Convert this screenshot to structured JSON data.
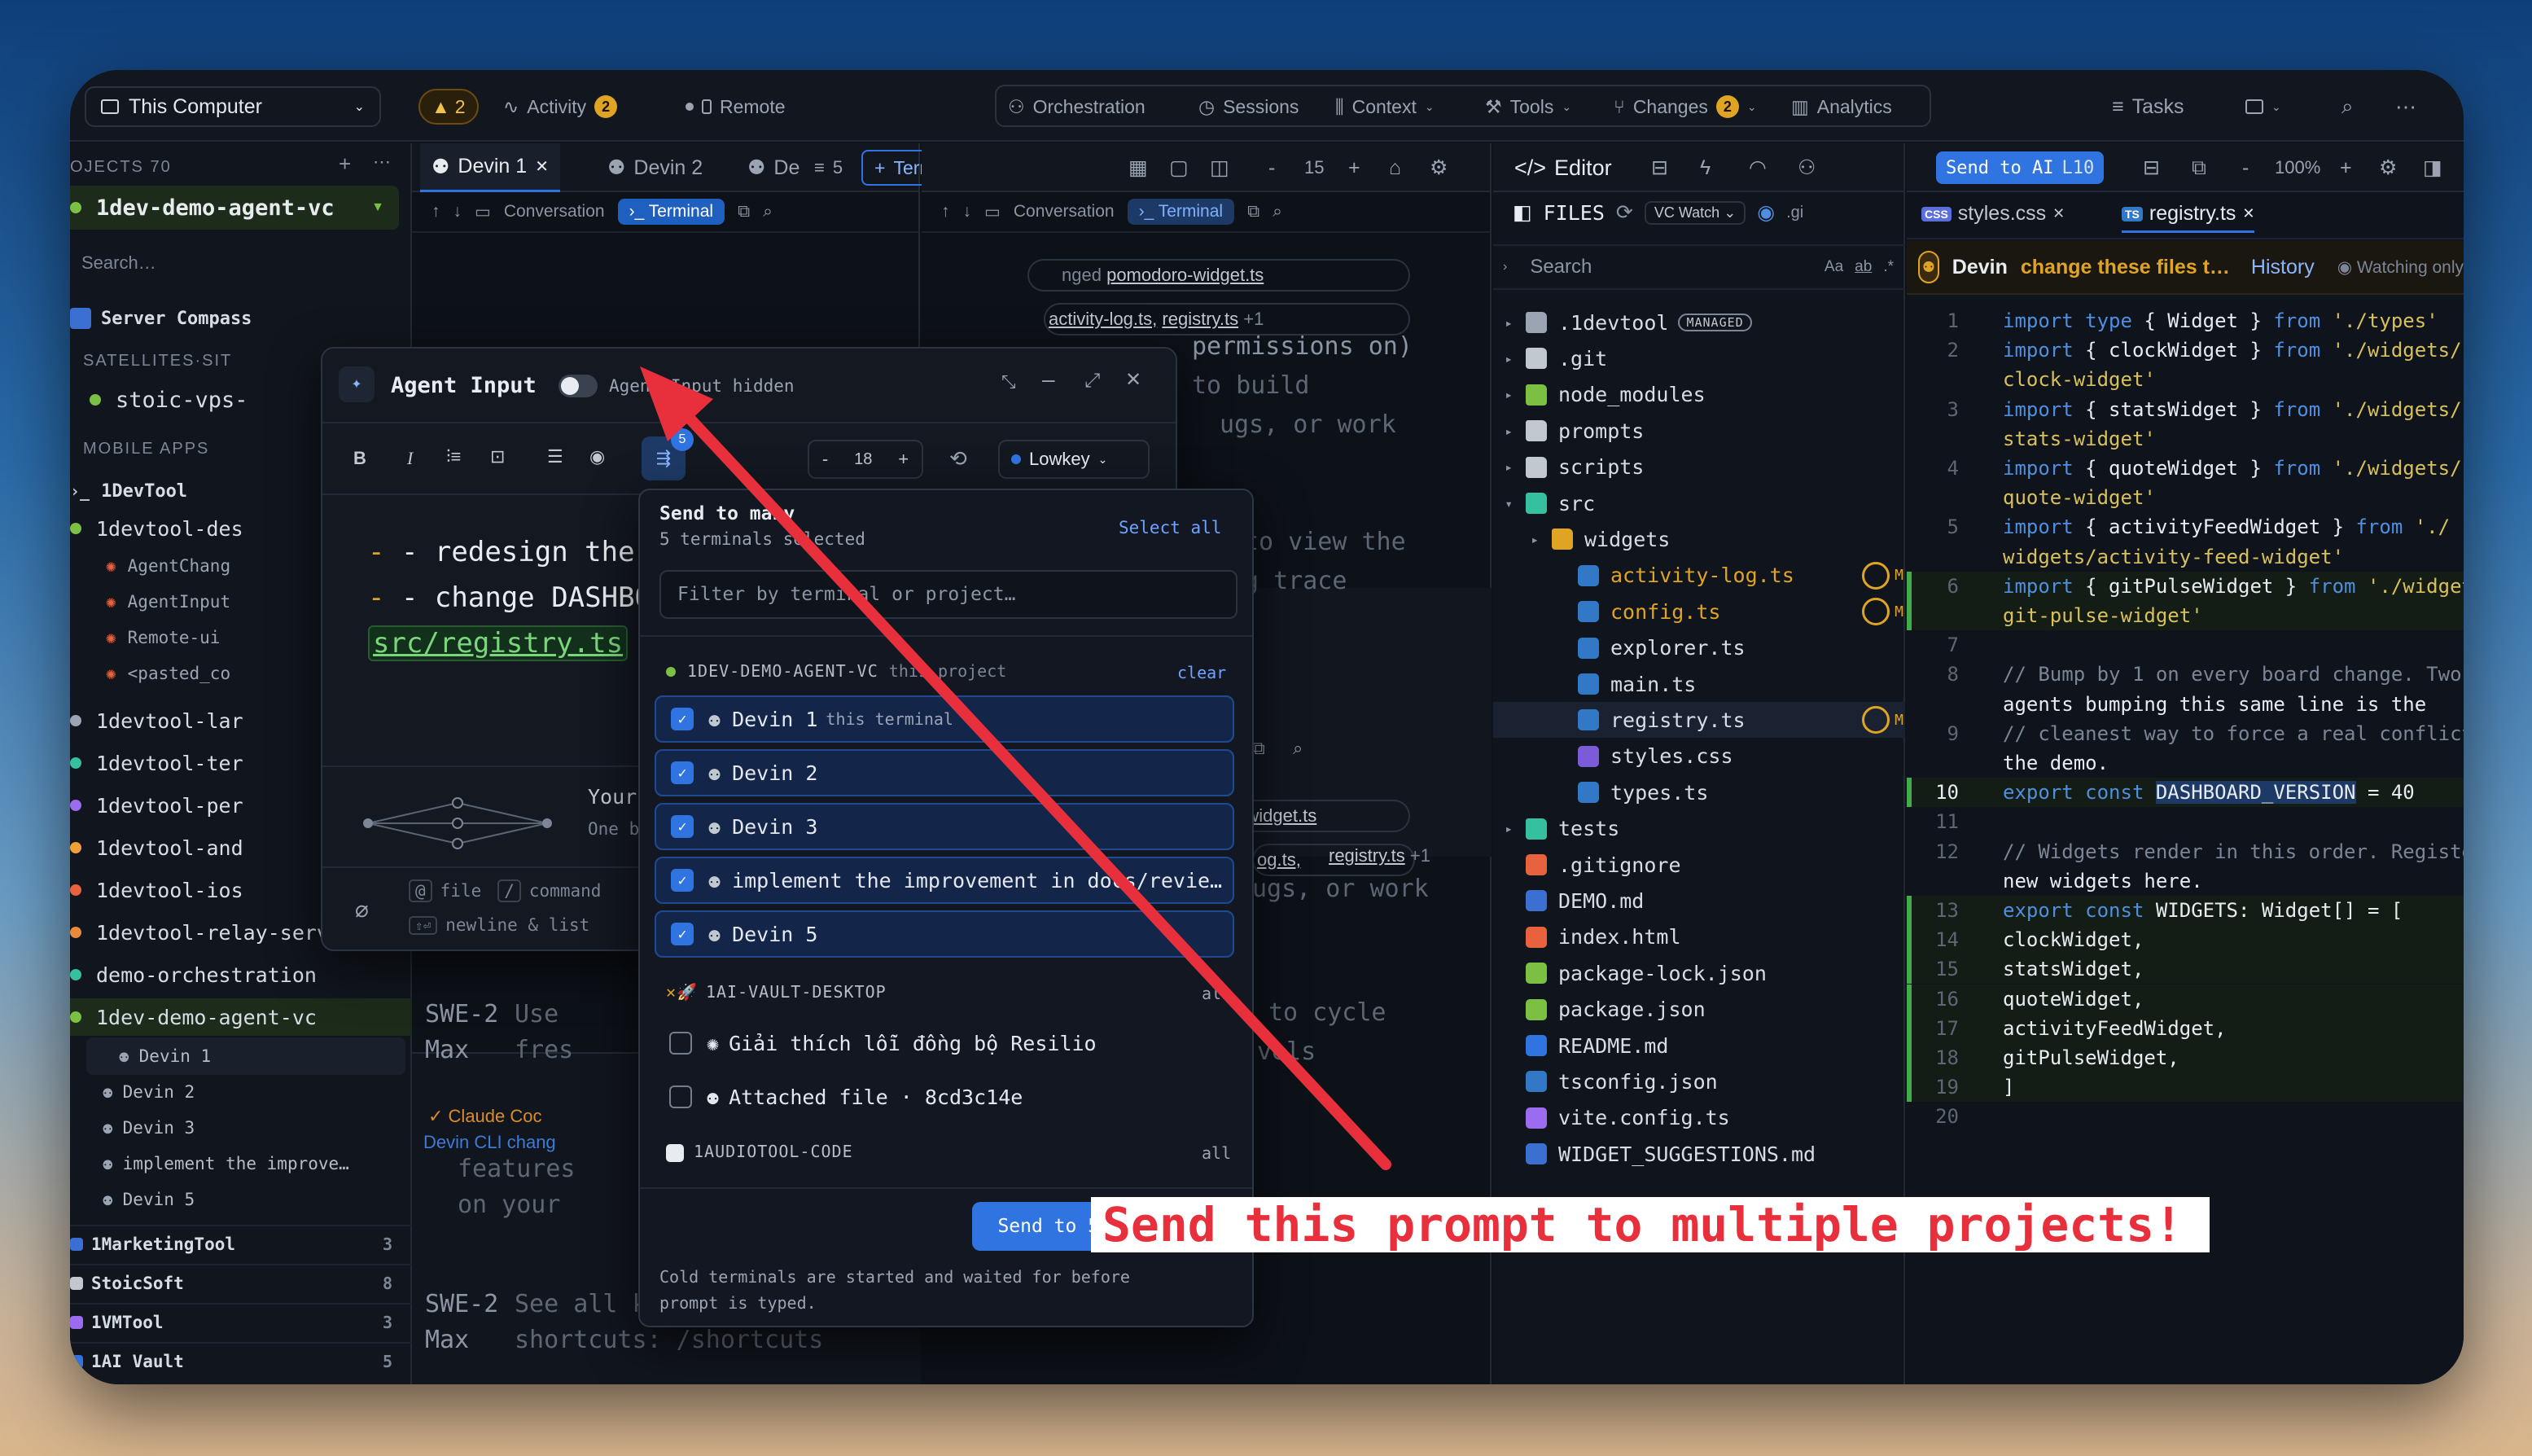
{
  "topbar": {
    "location": "This Computer",
    "warnings": "2",
    "activity": "Activity",
    "activity_count": "2",
    "remote": "Remote",
    "orchestration": "Orchestration",
    "sessions": "Sessions",
    "context": "Context",
    "tools": "Tools",
    "changes": "Changes",
    "changes_count": "2",
    "analytics": "Analytics",
    "tasks": "Tasks"
  },
  "sidebar": {
    "projects_header": "OJECTS 70",
    "current_project": "1dev-demo-agent-vc",
    "search_placeholder": "Search…",
    "server": "Server Compass",
    "satellites": "SATELLITES·SIT",
    "satellite_item": "stoic-vps-",
    "mobile_apps": "MOBILE APPS",
    "items": [
      "1DevTool",
      "1devtool-des",
      "AgentChang",
      "AgentInput",
      "Remote-ui",
      "<pasted_co",
      "1devtool-lar",
      "1devtool-ter",
      "1devtool-per",
      "1devtool-and",
      "1devtool-ios",
      "1devtool-relay-server",
      "demo-orchestration",
      "1dev-demo-agent-vc",
      "Devin 1",
      "Devin 2",
      "Devin 3",
      "implement the improve…",
      "Devin 5"
    ],
    "groups": [
      {
        "name": "1MarketingTool",
        "count": "3"
      },
      {
        "name": "StoicSoft",
        "count": "8"
      },
      {
        "name": "1VMTool",
        "count": "3"
      },
      {
        "name": "1AI Vault",
        "count": "5"
      }
    ]
  },
  "term_tabs": {
    "tab1": "Devin 1",
    "tab2": "Devin 2",
    "tab3": "De",
    "count": "5",
    "terminal": "Terminal",
    "size": "15",
    "conversation": "Conversation"
  },
  "term1_text": {
    "l1": "SWE-2",
    "l1b": "Use",
    "l2": "Max",
    "l2b": "fres",
    "l3": "SWE-2",
    "l3b": "See all keyboard",
    "l4": "Max",
    "l4b": "shortcuts: /shortcuts",
    "a1": "Claude Coc",
    "a2": "Devin CLI",
    "a3": "chang",
    "a4": "features",
    "a5": "on your"
  },
  "term2_text": {
    "t1": "nged",
    "t1b": "pomodoro-widget.ts",
    "t2": "activity-log.ts,",
    "t2b": "registry.ts",
    "t2c": "+1",
    "t3": "permissions on)",
    "t4": "to build",
    "t5": "ugs, or work",
    "t6": "to view the",
    "t7": "g trace",
    "t8": "pomodoro-widget.ts",
    "t9": "og.ts,",
    "t9b": "registry.ts",
    "t9c": "+1",
    "t10": "ugs, or work",
    "t11": "to cycle",
    "t12": "vels"
  },
  "editor_bar": {
    "editor": "Editor",
    "send_to_ai": "Send to AI",
    "send_line": "L10",
    "zoom": "100%"
  },
  "explorer": {
    "title": "FILES",
    "vc_watch": "VC Watch",
    "gi": ".gi",
    "search_placeholder": "Search",
    "aa": "Aa",
    "ab": "ab",
    "regex": ".*",
    "managed": "MANAGED",
    "tree": [
      ".1devtool",
      ".git",
      "node_modules",
      "prompts",
      "scripts",
      "src",
      "widgets",
      "activity-log.ts",
      "config.ts",
      "explorer.ts",
      "main.ts",
      "registry.ts",
      "styles.css",
      "types.ts",
      "tests",
      ".gitignore",
      "DEMO.md",
      "index.html",
      "package-lock.json",
      "package.json",
      "README.md",
      "tsconfig.json",
      "vite.config.ts",
      "WIDGET_SUGGESTIONS.md"
    ]
  },
  "editor": {
    "tab1": "styles.css",
    "tab2": "registry.ts",
    "agent": "Devin",
    "agent_msg": "change these files t…",
    "history": "History",
    "watching": "Watching only",
    "lines": [
      {
        "n": "1",
        "t": "import type { Widget } from './types'"
      },
      {
        "n": "2",
        "t": "import { clockWidget } from './widgets/"
      },
      {
        "n": "",
        "t": "clock-widget'"
      },
      {
        "n": "3",
        "t": "import { statsWidget } from './widgets/"
      },
      {
        "n": "",
        "t": "stats-widget'"
      },
      {
        "n": "4",
        "t": "import { quoteWidget } from './widgets/"
      },
      {
        "n": "",
        "t": "quote-widget'"
      },
      {
        "n": "5",
        "t": "import { activityFeedWidget } from './"
      },
      {
        "n": "",
        "t": "widgets/activity-feed-widget'"
      },
      {
        "n": "6",
        "t": "import { gitPulseWidget } from './widgets/"
      },
      {
        "n": "",
        "t": "git-pulse-widget'"
      },
      {
        "n": "7",
        "t": ""
      },
      {
        "n": "8",
        "t": "// Bump by 1 on every board change. Two"
      },
      {
        "n": "",
        "t": "agents bumping this same line is the"
      },
      {
        "n": "9",
        "t": "// cleanest way to force a real conflict in"
      },
      {
        "n": "",
        "t": "the demo."
      },
      {
        "n": "10",
        "t": "export const DASHBOARD_VERSION = 40"
      },
      {
        "n": "11",
        "t": ""
      },
      {
        "n": "12",
        "t": "// Widgets render in this order. Register"
      },
      {
        "n": "",
        "t": "new widgets here."
      },
      {
        "n": "13",
        "t": "export const WIDGETS: Widget[] = ["
      },
      {
        "n": "14",
        "t": "  clockWidget,"
      },
      {
        "n": "15",
        "t": "  statsWidget,"
      },
      {
        "n": "16",
        "t": "  quoteWidget,"
      },
      {
        "n": "17",
        "t": "  activityFeedWidget,"
      },
      {
        "n": "18",
        "t": "  gitPulseWidget,"
      },
      {
        "n": "19",
        "t": "]"
      },
      {
        "n": "20",
        "t": ""
      }
    ]
  },
  "agent_input": {
    "title": "Agent Input",
    "toggle_label": "Agent Input hidden",
    "font_size": "18",
    "model": "Lowkey",
    "send_badge": "5",
    "lines": [
      "- redesign the",
      "- change DASHBOA",
      "src/registry.ts"
    ],
    "your": "Your",
    "one": "One b",
    "file_key": "@",
    "file_label": "file",
    "cmd_key": "/",
    "cmd_label": "command",
    "newline_key": "⇧⏎",
    "newline_label": "newline & list"
  },
  "send_panel": {
    "title": "Send to many",
    "subtitle": "5 terminals selected",
    "select_all": "Select all",
    "filter_placeholder": "Filter by terminal or project…",
    "project1": "1DEV-DEMO-AGENT-VC",
    "project1_note": "this project",
    "clear": "clear",
    "terminals": [
      {
        "name": "Devin 1",
        "note": "this terminal"
      },
      {
        "name": "Devin 2",
        "note": ""
      },
      {
        "name": "Devin 3",
        "note": ""
      },
      {
        "name": "implement the improvement in docs/revie…",
        "note": ""
      },
      {
        "name": "Devin 5",
        "note": ""
      }
    ],
    "project2": "1AI-VAULT-DESKTOP",
    "project2_all": "all",
    "vault_items": [
      "Giải thích lỗi đồng bộ Resilio",
      "Attached file · 8cd3c14e"
    ],
    "project3": "1AUDIOTOOL-CODE",
    "project3_all": "all",
    "send_button": "Send to 5 terminals",
    "footer": "Cold terminals are started and waited for before prompt is typed."
  },
  "callout": "Send this prompt to multiple projects!",
  "colors": {
    "accent": "#2f74e0",
    "arrow": "#e8303d",
    "badge": "#e0a425"
  }
}
